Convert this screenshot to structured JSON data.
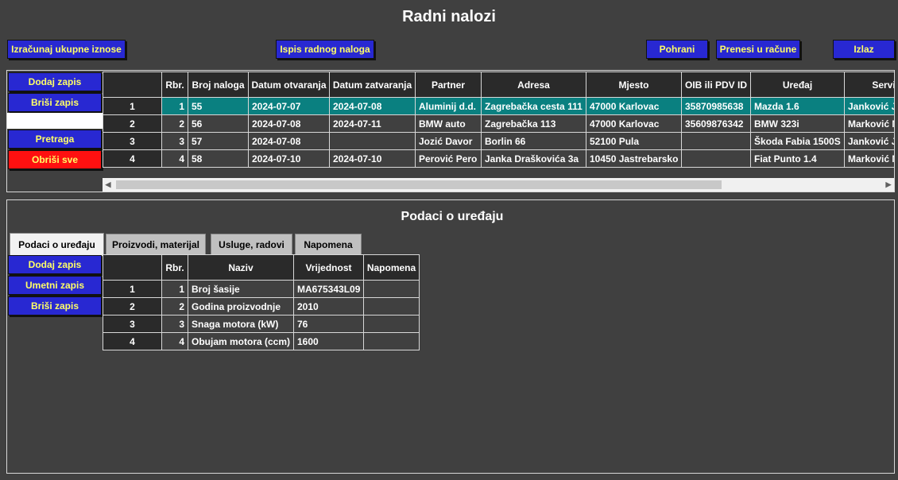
{
  "title": "Radni nalozi",
  "toolbar": {
    "calc": "Izračunaj ukupne iznose",
    "print": "Ispis radnog naloga",
    "save": "Pohrani",
    "transfer": "Prenesi u račune",
    "exit": "Izlaz"
  },
  "orders_panel": {
    "add": "Dodaj zapis",
    "delete": "Briši zapis",
    "search_value": "",
    "search": "Pretraga",
    "delete_all": "Obriši sve"
  },
  "orders_table": {
    "columns": [
      "",
      "Rbr.",
      "Broj naloga",
      "Datum otvaranja",
      "Datum zatvaranja",
      "Partner",
      "Adresa",
      "Mjesto",
      "OIB ili PDV ID",
      "Uređaj",
      "Serviser"
    ],
    "rows": [
      [
        "1",
        "1",
        "55",
        "2024-07-07",
        "2024-07-08",
        "Aluminij d.d.",
        "Zagrebačka cesta 111",
        "47000 Karlovac",
        "35870985638",
        "Mazda 1.6",
        "Janković J"
      ],
      [
        "2",
        "2",
        "56",
        "2024-07-08",
        "2024-07-11",
        "BMW auto",
        "Zagrebačka 113",
        "47000 Karlovac",
        "35609876342",
        "BMW 323i",
        "Marković M"
      ],
      [
        "3",
        "3",
        "57",
        "2024-07-08",
        "",
        "Jozić Davor",
        "Borlin 66",
        "52100 Pula",
        "",
        "Škoda Fabia 1500S",
        "Janković J"
      ],
      [
        "4",
        "4",
        "58",
        "2024-07-10",
        "2024-07-10",
        "Perović Pero",
        "Janka Draškovića 3a",
        "10450 Jastrebarsko",
        "",
        "Fiat Punto 1.4",
        "Marković M"
      ]
    ],
    "selected_row": 0
  },
  "device": {
    "title": "Podaci o uređaju",
    "tabs": [
      "Podaci o uređaju",
      "Proizvodi, materijal",
      "Usluge, radovi",
      "Napomena"
    ],
    "add": "Dodaj zapis",
    "insert": "Umetni zapis",
    "delete": "Briši zapis",
    "columns": [
      "",
      "Rbr.",
      "Naziv",
      "Vrijednost",
      "Napomena"
    ],
    "rows": [
      [
        "1",
        "1",
        "Broj šasije",
        "MA675343L09",
        ""
      ],
      [
        "2",
        "2",
        "Godina proizvodnje",
        "2010",
        ""
      ],
      [
        "3",
        "3",
        "Snaga motora (kW)",
        "76",
        ""
      ],
      [
        "4",
        "4",
        "Obujam motora (ccm)",
        "1600",
        ""
      ]
    ]
  },
  "colors": {
    "background": "#404040",
    "button": "#2828d2",
    "button_text": "#ffff66",
    "danger": "#ff1010",
    "selected_row": "#0a8080"
  }
}
